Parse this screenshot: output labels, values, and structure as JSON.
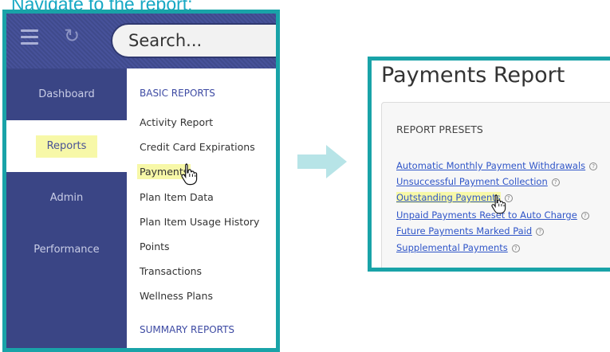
{
  "heading": "Navigate to the report:",
  "search": {
    "placeholder": "Search..."
  },
  "sidebar": {
    "items": [
      {
        "label": "Dashboard"
      },
      {
        "label": "Reports"
      },
      {
        "label": "Admin"
      },
      {
        "label": "Performance"
      }
    ]
  },
  "menu": {
    "basic_heading": "BASIC REPORTS",
    "items": [
      {
        "label": "Activity Report"
      },
      {
        "label": "Credit Card Expirations"
      },
      {
        "label": "Payments"
      },
      {
        "label": "Plan Item Data"
      },
      {
        "label": "Plan Item Usage History"
      },
      {
        "label": "Points"
      },
      {
        "label": "Transactions"
      },
      {
        "label": "Wellness Plans"
      }
    ],
    "summary_heading": "SUMMARY REPORTS"
  },
  "report": {
    "title": "Payments Report",
    "presets_heading": "REPORT PRESETS",
    "links": [
      {
        "label": "Automatic Monthly Payment Withdrawals"
      },
      {
        "label": "Unsuccessful Payment Collection"
      },
      {
        "label": "Outstanding Payments"
      },
      {
        "label": "Unpaid Payments Reset to Auto Charge"
      },
      {
        "label": "Future Payments Marked Paid"
      },
      {
        "label": "Supplemental Payments"
      }
    ],
    "help_glyph": "?"
  },
  "colors": {
    "accent_border": "#19a3a8",
    "nav_background": "#3a4585",
    "highlight": "#f7f8a8",
    "link": "#2f55c8"
  },
  "icons": {
    "menu": "hamburger-icon",
    "refresh": "refresh-icon",
    "cursor": "hand-pointer-icon",
    "arrow": "right-arrow-icon",
    "help": "help-circle-icon"
  }
}
